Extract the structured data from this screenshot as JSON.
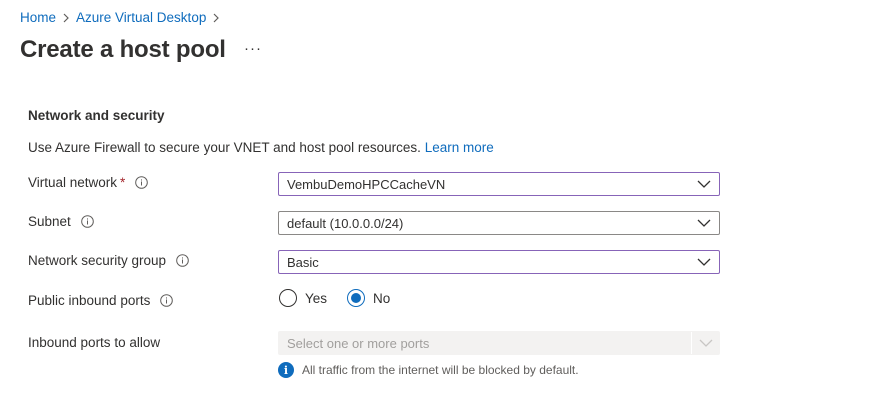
{
  "breadcrumb": {
    "items": [
      "Home",
      "Azure Virtual Desktop"
    ]
  },
  "page": {
    "title": "Create a host pool",
    "more_label": "···"
  },
  "section": {
    "title": "Network and security",
    "description": "Use Azure Firewall to secure your VNET and host pool resources.",
    "learn_more": "Learn more"
  },
  "fields": {
    "virtual_network": {
      "label": "Virtual network",
      "required": "*",
      "value": "VembuDemoHPCCacheVN"
    },
    "subnet": {
      "label": "Subnet",
      "value": "default (10.0.0.0/24)"
    },
    "nsg": {
      "label": "Network security group",
      "value": "Basic"
    },
    "public_inbound": {
      "label": "Public inbound ports",
      "options": [
        "Yes",
        "No"
      ],
      "selected": "No"
    },
    "inbound_ports": {
      "label": "Inbound ports to allow",
      "placeholder": "Select one or more ports"
    }
  },
  "note": {
    "icon": "i",
    "text": "All traffic from the internet will be blocked by default."
  },
  "colors": {
    "link": "#0f6cbd",
    "focus_border": "#8764b8",
    "required": "#a4262c"
  }
}
